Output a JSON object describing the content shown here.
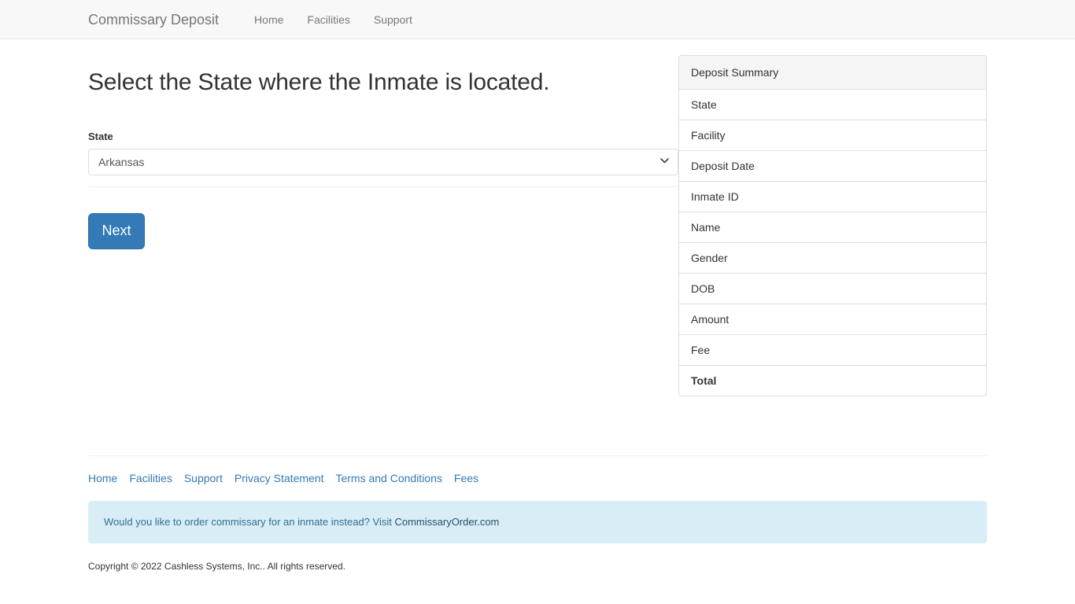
{
  "navbar": {
    "brand": "Commissary Deposit",
    "links": [
      {
        "label": "Home"
      },
      {
        "label": "Facilities"
      },
      {
        "label": "Support"
      }
    ]
  },
  "main": {
    "title": "Select the State where the Inmate is located.",
    "form": {
      "state_label": "State",
      "state_value": "Arkansas",
      "state_options": [
        "Arkansas"
      ],
      "next_label": "Next"
    }
  },
  "summary": {
    "heading": "Deposit Summary",
    "rows": [
      {
        "label": "State",
        "value": ""
      },
      {
        "label": "Facility",
        "value": ""
      },
      {
        "label": "Deposit Date",
        "value": ""
      },
      {
        "label": "Inmate ID",
        "value": ""
      },
      {
        "label": "Name",
        "value": ""
      },
      {
        "label": "Gender",
        "value": ""
      },
      {
        "label": "DOB",
        "value": ""
      },
      {
        "label": "Amount",
        "value": ""
      },
      {
        "label": "Fee",
        "value": ""
      },
      {
        "label": "Total",
        "value": ""
      }
    ]
  },
  "footer": {
    "links": [
      {
        "label": "Home"
      },
      {
        "label": "Facilities"
      },
      {
        "label": "Support"
      },
      {
        "label": "Privacy Statement"
      },
      {
        "label": "Terms and Conditions"
      },
      {
        "label": "Fees"
      }
    ],
    "alert_text": "Would you like to order commissary for an inmate instead? Visit ",
    "alert_link": "CommissaryOrder.com",
    "copyright": "Copyright © 2022 Cashless Systems, Inc.. All rights reserved."
  },
  "colors": {
    "primary": "#337ab7",
    "navbar_bg": "#f8f8f8",
    "alert_bg": "#d9edf7",
    "alert_text": "#31708f",
    "panel_head_bg": "#f5f5f5"
  }
}
